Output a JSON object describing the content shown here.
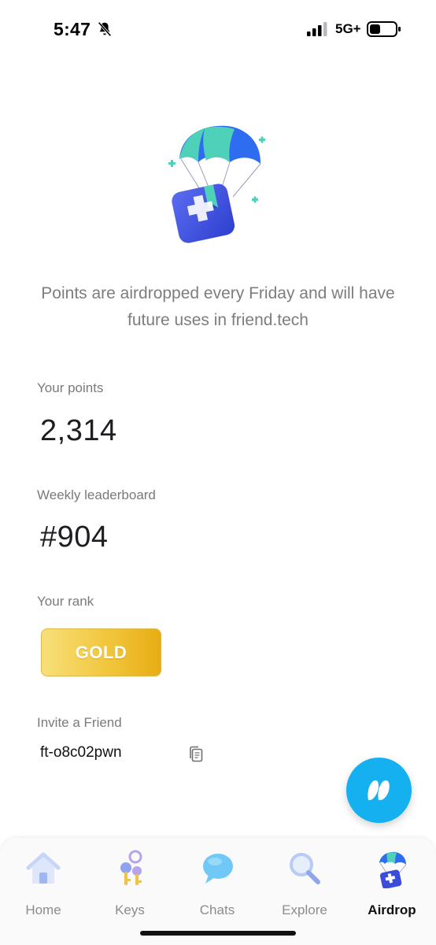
{
  "status_bar": {
    "time": "5:47",
    "network": "5G+",
    "icons": [
      "bell-off-icon",
      "signal-icon",
      "battery-icon"
    ]
  },
  "hero": {
    "illustration": "parachute-gift-box-illustration",
    "text": "Points are airdropped every Friday and will have future uses in friend.tech"
  },
  "points": {
    "label": "Your points",
    "value": "2,314"
  },
  "leaderboard": {
    "label": "Weekly leaderboard",
    "value": "#904"
  },
  "rank": {
    "label": "Your rank",
    "badge": "GOLD",
    "badge_color": "#f1c63d"
  },
  "invite": {
    "label": "Invite a Friend",
    "code": "ft-o8c02pwn",
    "copy_icon": "copy-icon"
  },
  "fab": {
    "icon": "friendtech-logo-icon",
    "color": "#14b0ef"
  },
  "tab_bar": {
    "tabs": [
      {
        "label": "Home",
        "icon": "home-icon",
        "active": false
      },
      {
        "label": "Keys",
        "icon": "keys-icon",
        "active": false
      },
      {
        "label": "Chats",
        "icon": "chat-bubble-icon",
        "active": false
      },
      {
        "label": "Explore",
        "icon": "magnifier-icon",
        "active": false
      },
      {
        "label": "Airdrop",
        "icon": "airdrop-icon",
        "active": true
      }
    ]
  }
}
